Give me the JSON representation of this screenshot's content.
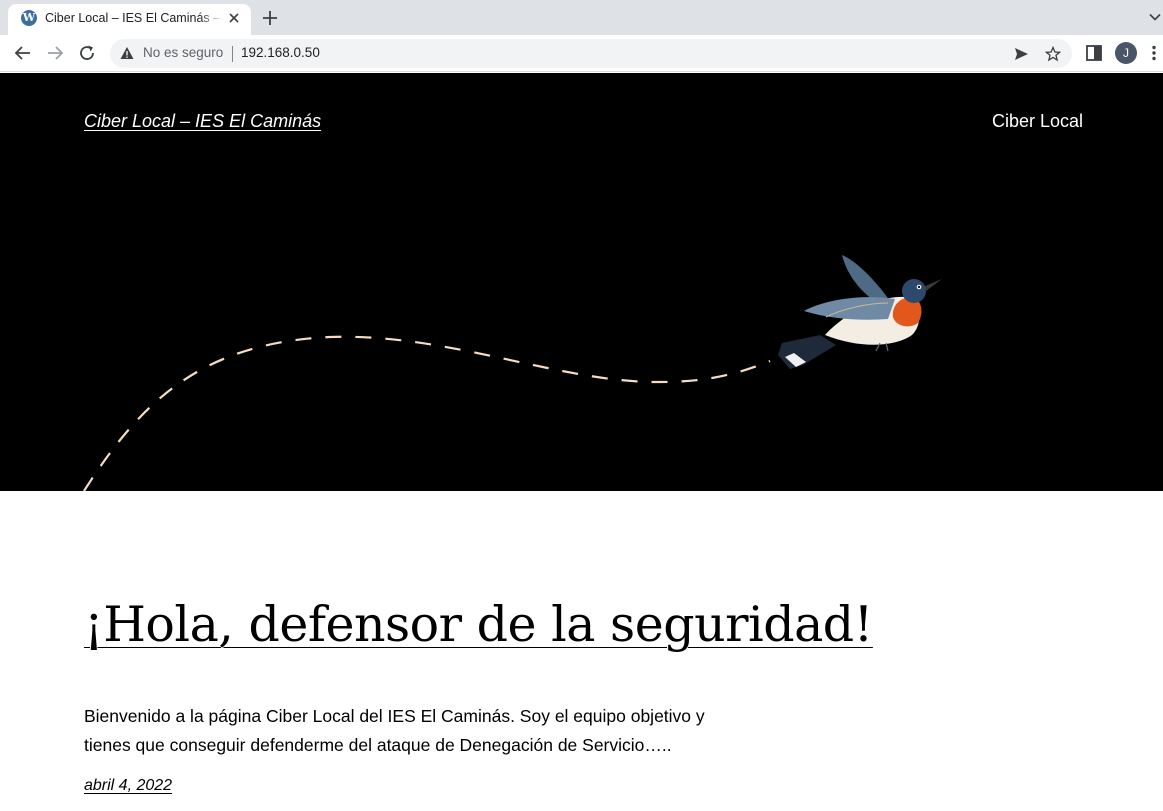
{
  "browser": {
    "tab_title": "Ciber Local – IES El Caminás – Ciber Local",
    "security_label": "No es seguro",
    "url": "192.168.0.50",
    "profile_initial": "J"
  },
  "site": {
    "title": "Ciber Local – IES El Caminás",
    "nav_link": "Ciber Local"
  },
  "post": {
    "title": "¡Hola, defensor de la seguridad!",
    "excerpt": "Bienvenido a la página Ciber Local del IES El Caminás. Soy el equipo objetivo y tienes que conseguir defenderme del ataque de Denegación de Servicio…..",
    "date": "abril 4, 2022"
  },
  "colors": {
    "hero_bg": "#000000",
    "dashed_path": "#f5dcc4",
    "bird_orange": "#e2571b",
    "bird_blue": "#2d4a6e"
  },
  "icons": [
    "wordpress-icon",
    "close-icon",
    "plus-icon",
    "back-icon",
    "forward-icon",
    "reload-icon",
    "warning-icon",
    "send-icon",
    "star-icon",
    "side-panel-icon",
    "menu-icon",
    "chevron-down-icon"
  ]
}
